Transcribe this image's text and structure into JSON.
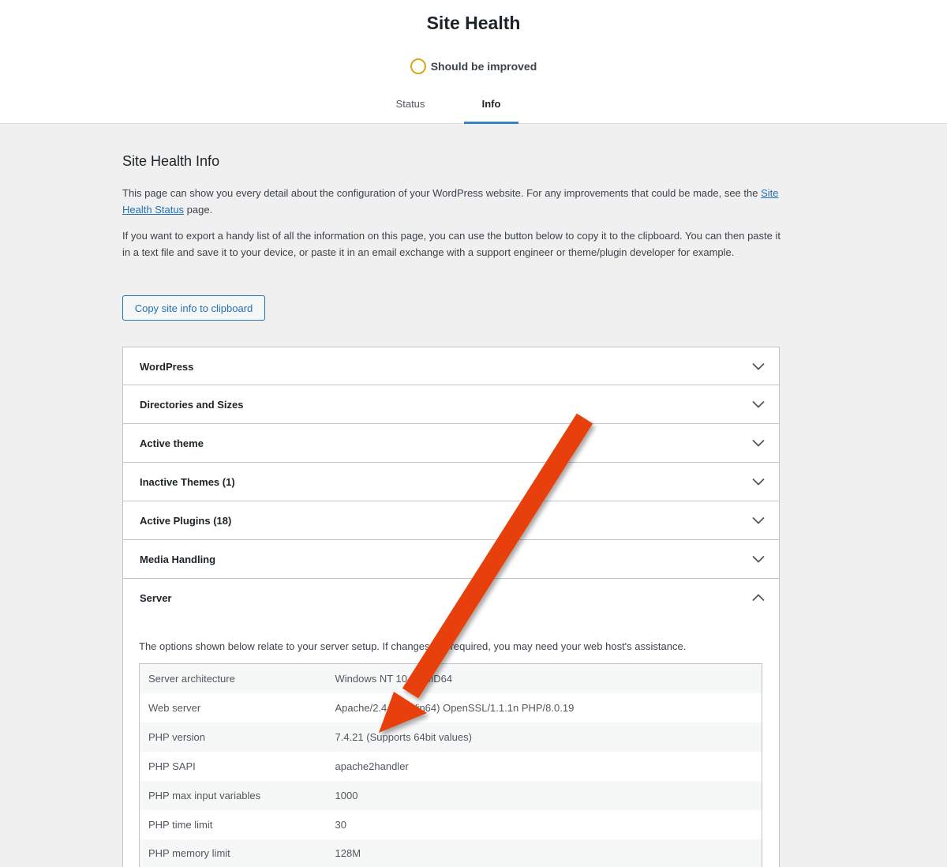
{
  "header": {
    "title": "Site Health",
    "status_label": "Should be improved",
    "status_color": "#dba617",
    "tabs": [
      {
        "label": "Status",
        "active": false
      },
      {
        "label": "Info",
        "active": true
      }
    ]
  },
  "main": {
    "title": "Site Health Info",
    "intro_before_link": "This page can show you every detail about the configuration of your WordPress website. For any improvements that could be made, see the ",
    "intro_link": "Site Health Status",
    "intro_after_link": " page.",
    "export_text": "If you want to export a handy list of all the information on this page, you can use the button below to copy it to the clipboard. You can then paste it in a text file and save it to your device, or paste it in an email exchange with a support engineer or theme/plugin developer for example.",
    "copy_button": "Copy site info to clipboard"
  },
  "accordion": {
    "items": [
      {
        "label": "WordPress"
      },
      {
        "label": "Directories and Sizes"
      },
      {
        "label": "Active theme"
      },
      {
        "label": "Inactive Themes (1)"
      },
      {
        "label": "Active Plugins (18)"
      },
      {
        "label": "Media Handling"
      }
    ],
    "open_item": {
      "label": "Server",
      "description": "The options shown below relate to your server setup. If changes are required, you may need your web host's assistance.",
      "rows": [
        {
          "key": "Server architecture",
          "value": "Windows NT 10.0 AMD64"
        },
        {
          "key": "Web server",
          "value": "Apache/2.4.53 (Win64) OpenSSL/1.1.1n PHP/8.0.19"
        },
        {
          "key": "PHP version",
          "value": "7.4.21 (Supports 64bit values)"
        },
        {
          "key": "PHP SAPI",
          "value": "apache2handler"
        },
        {
          "key": "PHP max input variables",
          "value": "1000"
        },
        {
          "key": "PHP time limit",
          "value": "30"
        },
        {
          "key": "PHP memory limit",
          "value": "128M"
        }
      ]
    }
  },
  "annotation": {
    "arrow_color": "#e8410f",
    "icon": "arrow-annotation-icon"
  }
}
